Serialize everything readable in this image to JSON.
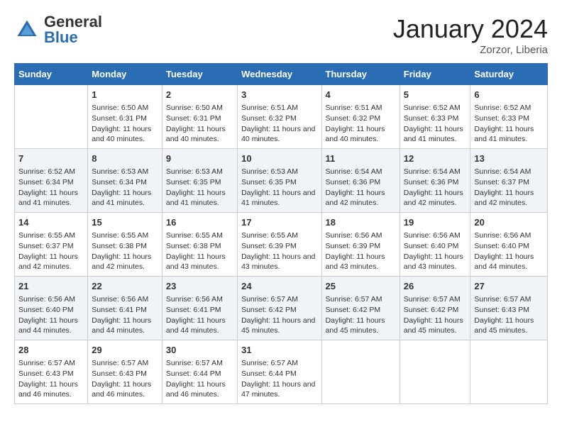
{
  "header": {
    "logo_general": "General",
    "logo_blue": "Blue",
    "month_year": "January 2024",
    "location": "Zorzor, Liberia"
  },
  "days_of_week": [
    "Sunday",
    "Monday",
    "Tuesday",
    "Wednesday",
    "Thursday",
    "Friday",
    "Saturday"
  ],
  "weeks": [
    [
      {
        "day": "",
        "sunrise": "",
        "sunset": "",
        "daylight": ""
      },
      {
        "day": "1",
        "sunrise": "Sunrise: 6:50 AM",
        "sunset": "Sunset: 6:31 PM",
        "daylight": "Daylight: 11 hours and 40 minutes."
      },
      {
        "day": "2",
        "sunrise": "Sunrise: 6:50 AM",
        "sunset": "Sunset: 6:31 PM",
        "daylight": "Daylight: 11 hours and 40 minutes."
      },
      {
        "day": "3",
        "sunrise": "Sunrise: 6:51 AM",
        "sunset": "Sunset: 6:32 PM",
        "daylight": "Daylight: 11 hours and 40 minutes."
      },
      {
        "day": "4",
        "sunrise": "Sunrise: 6:51 AM",
        "sunset": "Sunset: 6:32 PM",
        "daylight": "Daylight: 11 hours and 40 minutes."
      },
      {
        "day": "5",
        "sunrise": "Sunrise: 6:52 AM",
        "sunset": "Sunset: 6:33 PM",
        "daylight": "Daylight: 11 hours and 41 minutes."
      },
      {
        "day": "6",
        "sunrise": "Sunrise: 6:52 AM",
        "sunset": "Sunset: 6:33 PM",
        "daylight": "Daylight: 11 hours and 41 minutes."
      }
    ],
    [
      {
        "day": "7",
        "sunrise": "Sunrise: 6:52 AM",
        "sunset": "Sunset: 6:34 PM",
        "daylight": "Daylight: 11 hours and 41 minutes."
      },
      {
        "day": "8",
        "sunrise": "Sunrise: 6:53 AM",
        "sunset": "Sunset: 6:34 PM",
        "daylight": "Daylight: 11 hours and 41 minutes."
      },
      {
        "day": "9",
        "sunrise": "Sunrise: 6:53 AM",
        "sunset": "Sunset: 6:35 PM",
        "daylight": "Daylight: 11 hours and 41 minutes."
      },
      {
        "day": "10",
        "sunrise": "Sunrise: 6:53 AM",
        "sunset": "Sunset: 6:35 PM",
        "daylight": "Daylight: 11 hours and 41 minutes."
      },
      {
        "day": "11",
        "sunrise": "Sunrise: 6:54 AM",
        "sunset": "Sunset: 6:36 PM",
        "daylight": "Daylight: 11 hours and 42 minutes."
      },
      {
        "day": "12",
        "sunrise": "Sunrise: 6:54 AM",
        "sunset": "Sunset: 6:36 PM",
        "daylight": "Daylight: 11 hours and 42 minutes."
      },
      {
        "day": "13",
        "sunrise": "Sunrise: 6:54 AM",
        "sunset": "Sunset: 6:37 PM",
        "daylight": "Daylight: 11 hours and 42 minutes."
      }
    ],
    [
      {
        "day": "14",
        "sunrise": "Sunrise: 6:55 AM",
        "sunset": "Sunset: 6:37 PM",
        "daylight": "Daylight: 11 hours and 42 minutes."
      },
      {
        "day": "15",
        "sunrise": "Sunrise: 6:55 AM",
        "sunset": "Sunset: 6:38 PM",
        "daylight": "Daylight: 11 hours and 42 minutes."
      },
      {
        "day": "16",
        "sunrise": "Sunrise: 6:55 AM",
        "sunset": "Sunset: 6:38 PM",
        "daylight": "Daylight: 11 hours and 43 minutes."
      },
      {
        "day": "17",
        "sunrise": "Sunrise: 6:55 AM",
        "sunset": "Sunset: 6:39 PM",
        "daylight": "Daylight: 11 hours and 43 minutes."
      },
      {
        "day": "18",
        "sunrise": "Sunrise: 6:56 AM",
        "sunset": "Sunset: 6:39 PM",
        "daylight": "Daylight: 11 hours and 43 minutes."
      },
      {
        "day": "19",
        "sunrise": "Sunrise: 6:56 AM",
        "sunset": "Sunset: 6:40 PM",
        "daylight": "Daylight: 11 hours and 43 minutes."
      },
      {
        "day": "20",
        "sunrise": "Sunrise: 6:56 AM",
        "sunset": "Sunset: 6:40 PM",
        "daylight": "Daylight: 11 hours and 44 minutes."
      }
    ],
    [
      {
        "day": "21",
        "sunrise": "Sunrise: 6:56 AM",
        "sunset": "Sunset: 6:40 PM",
        "daylight": "Daylight: 11 hours and 44 minutes."
      },
      {
        "day": "22",
        "sunrise": "Sunrise: 6:56 AM",
        "sunset": "Sunset: 6:41 PM",
        "daylight": "Daylight: 11 hours and 44 minutes."
      },
      {
        "day": "23",
        "sunrise": "Sunrise: 6:56 AM",
        "sunset": "Sunset: 6:41 PM",
        "daylight": "Daylight: 11 hours and 44 minutes."
      },
      {
        "day": "24",
        "sunrise": "Sunrise: 6:57 AM",
        "sunset": "Sunset: 6:42 PM",
        "daylight": "Daylight: 11 hours and 45 minutes."
      },
      {
        "day": "25",
        "sunrise": "Sunrise: 6:57 AM",
        "sunset": "Sunset: 6:42 PM",
        "daylight": "Daylight: 11 hours and 45 minutes."
      },
      {
        "day": "26",
        "sunrise": "Sunrise: 6:57 AM",
        "sunset": "Sunset: 6:42 PM",
        "daylight": "Daylight: 11 hours and 45 minutes."
      },
      {
        "day": "27",
        "sunrise": "Sunrise: 6:57 AM",
        "sunset": "Sunset: 6:43 PM",
        "daylight": "Daylight: 11 hours and 45 minutes."
      }
    ],
    [
      {
        "day": "28",
        "sunrise": "Sunrise: 6:57 AM",
        "sunset": "Sunset: 6:43 PM",
        "daylight": "Daylight: 11 hours and 46 minutes."
      },
      {
        "day": "29",
        "sunrise": "Sunrise: 6:57 AM",
        "sunset": "Sunset: 6:43 PM",
        "daylight": "Daylight: 11 hours and 46 minutes."
      },
      {
        "day": "30",
        "sunrise": "Sunrise: 6:57 AM",
        "sunset": "Sunset: 6:44 PM",
        "daylight": "Daylight: 11 hours and 46 minutes."
      },
      {
        "day": "31",
        "sunrise": "Sunrise: 6:57 AM",
        "sunset": "Sunset: 6:44 PM",
        "daylight": "Daylight: 11 hours and 47 minutes."
      },
      {
        "day": "",
        "sunrise": "",
        "sunset": "",
        "daylight": ""
      },
      {
        "day": "",
        "sunrise": "",
        "sunset": "",
        "daylight": ""
      },
      {
        "day": "",
        "sunrise": "",
        "sunset": "",
        "daylight": ""
      }
    ]
  ]
}
